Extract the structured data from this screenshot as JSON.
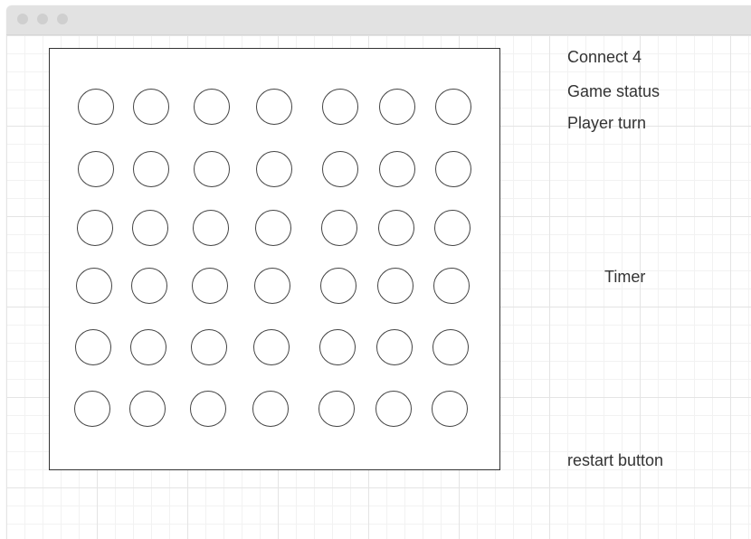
{
  "window": {
    "controls": [
      "close",
      "minimize",
      "maximize"
    ]
  },
  "board": {
    "rows": 6,
    "columns": 7
  },
  "sidebar": {
    "title": "Connect 4",
    "game_status": "Game status",
    "player_turn": "Player turn",
    "timer": "Timer",
    "restart": "restart button"
  }
}
